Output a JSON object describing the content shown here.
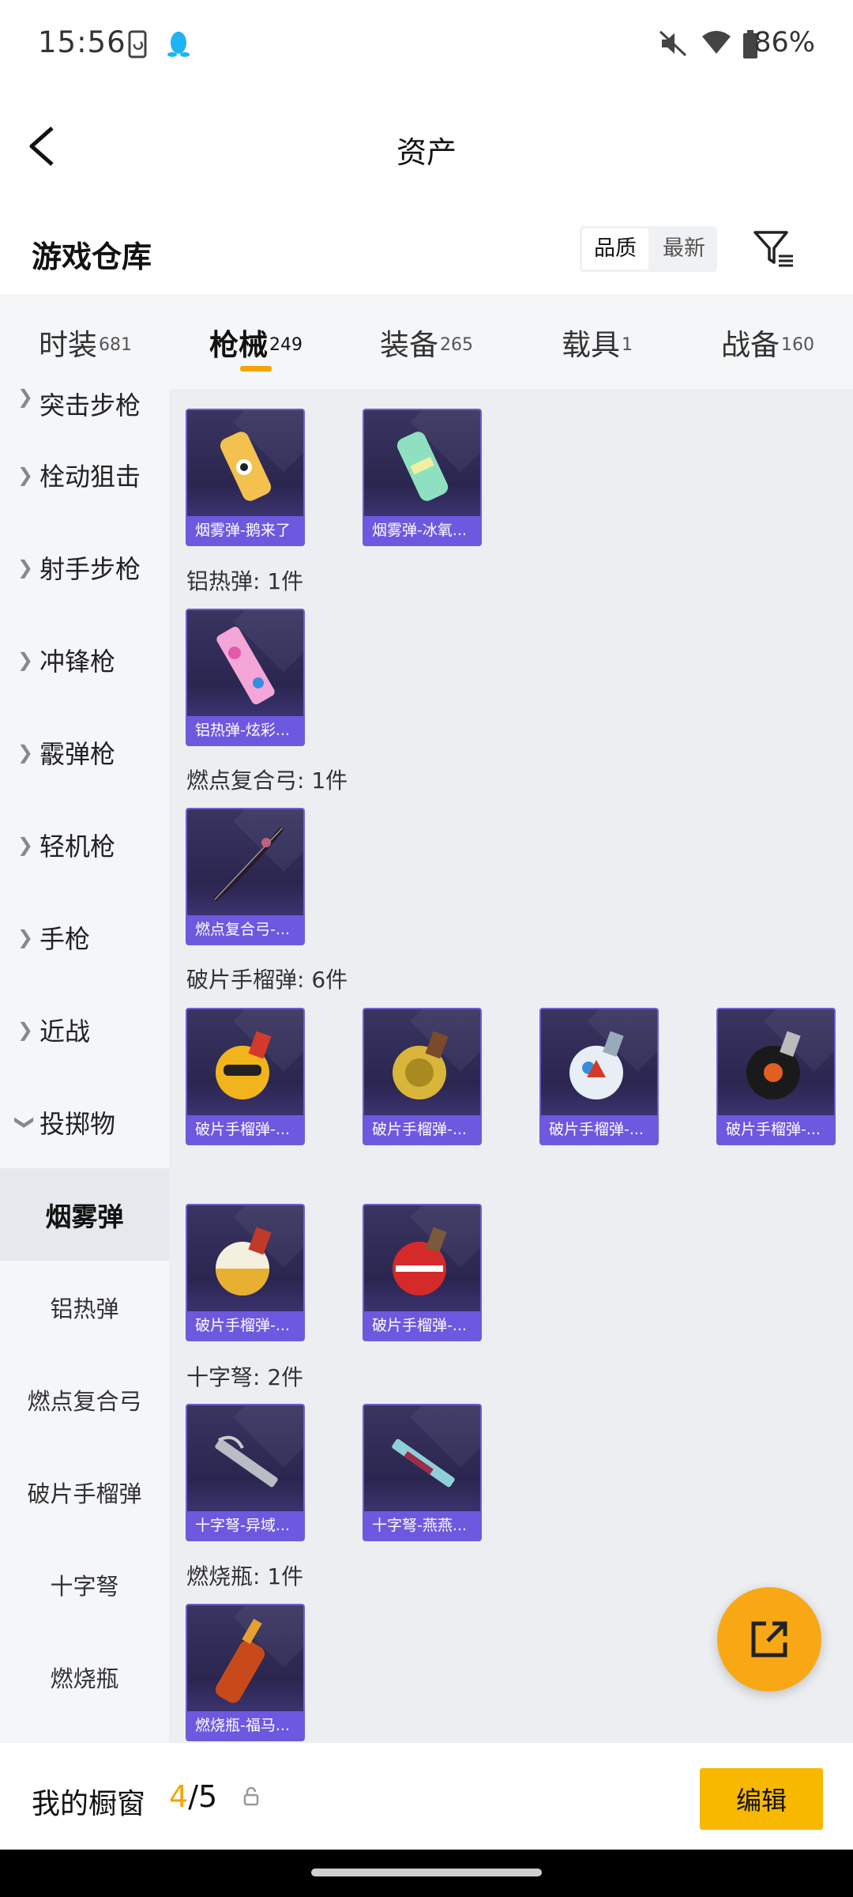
{
  "status_bar": {
    "time": "15:56",
    "battery": "86%"
  },
  "title": "资产",
  "section": {
    "title": "游戏仓库",
    "sort_options": [
      "品质",
      "最新"
    ]
  },
  "tabs": [
    {
      "label": "时装",
      "count": "681"
    },
    {
      "label": "枪械",
      "count": "249"
    },
    {
      "label": "装备",
      "count": "265"
    },
    {
      "label": "载具",
      "count": "1"
    },
    {
      "label": "战备",
      "count": "160"
    }
  ],
  "sidebar": {
    "categories": [
      "突击步枪",
      "栓动狙击",
      "射手步枪",
      "冲锋枪",
      "霰弹枪",
      "轻机枪",
      "手枪",
      "近战",
      "投掷物"
    ],
    "subcategories": [
      "烟雾弹",
      "铝热弹",
      "燃点复合弓",
      "破片手榴弹",
      "十字弩",
      "燃烧瓶"
    ]
  },
  "groups": {
    "smoke": {
      "items": [
        "烟雾弹-鹅来了",
        "烟雾弹-冰氧..."
      ]
    },
    "thermite": {
      "label": "铝热弹: 1件",
      "items": [
        "铝热弹-炫彩..."
      ]
    },
    "bow": {
      "label": "燃点复合弓: 1件",
      "items": [
        "燃点复合弓-..."
      ]
    },
    "frag": {
      "label": "破片手榴弹: 6件",
      "items": [
        "破片手榴弹-...",
        "破片手榴弹-...",
        "破片手榴弹-...",
        "破片手榴弹-...",
        "破片手榴弹-...",
        "破片手榴弹-..."
      ]
    },
    "crossbow": {
      "label": "十字弩: 2件",
      "items": [
        "十字弩-异域...",
        "十字弩-燕燕..."
      ]
    },
    "molotov": {
      "label": "燃烧瓶: 1件",
      "items": [
        "燃烧瓶-福马..."
      ]
    }
  },
  "bottom_bar": {
    "label": "我的橱窗",
    "current": "4",
    "total": "/5",
    "edit_label": "编辑"
  },
  "icons": {
    "back": "back-arrow-icon",
    "filter": "filter-list-icon",
    "share": "share-external-icon",
    "lock": "lock-icon",
    "phone": "phone-rotate-icon",
    "qq": "qq-penguin-icon",
    "mute": "mute-icon",
    "wifi": "wifi-icon",
    "battery": "battery-icon"
  },
  "colors": {
    "accent": "#f5a400",
    "card_caption": "#6d58e0",
    "edit_button": "#f8b800"
  }
}
